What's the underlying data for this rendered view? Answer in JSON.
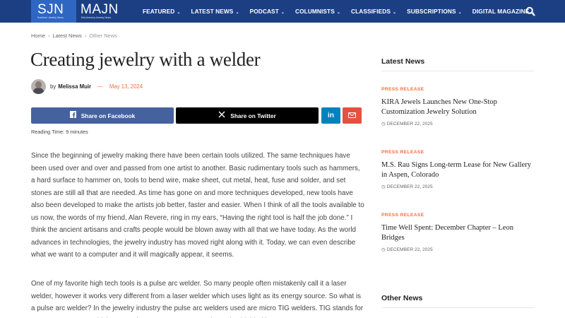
{
  "brand": {
    "logo1": "SJN",
    "logo1_tagline": "Southern Jewelry News",
    "logo2": "MAJN",
    "logo2_tagline": "Mid-America Jewelry News",
    "primary_color": "#1c3f84",
    "accent_color": "#ff6b3d"
  },
  "nav": {
    "items": [
      {
        "label": "FEATURED"
      },
      {
        "label": "LATEST NEWS"
      },
      {
        "label": "PODCAST"
      },
      {
        "label": "COLUMNISTS"
      },
      {
        "label": "CLASSIFIEDS"
      },
      {
        "label": "SUBSCRIPTIONS"
      },
      {
        "label": "DIGITAL MAGAZINE"
      }
    ],
    "chevron": "⌄",
    "search_icon": "search-icon"
  },
  "breadcrumb": {
    "home": "Home",
    "section": "Latest News",
    "current": "Other News",
    "separator": "›"
  },
  "article": {
    "title": "Creating jewelry with a welder",
    "by": "by",
    "author": "Melissa Muir",
    "dash": "—",
    "date": "May 13, 2024",
    "reading_time": "Reading Time: 9 minutes",
    "paragraphs": [
      "Since the beginning of jewelry making there have been certain tools utilized. The same techniques have been used over and over and passed from one artist to another. Basic rudimentary tools such as hammers, a hard surface to hammer on, tools to bend wire, make sheet, cut metal, heat, fuse and solder, and set stones are still all that are needed. As time has gone on and more techniques developed, new tools have also been developed to make the artists job better, faster and easier. When I think of all the tools available to us now, the words of my friend, Alan Revere, ring in my ears, “Having the right tool is half the job done.” I think the ancient artisans and crafts people would be blown away with all that we have today. As the world advances in technologies, the jewelry industry has moved right along with it. Today, we can even describe what we want to a computer and it will magically appear, it seems.",
      "One of my favorite high tech tools is a pulse arc welder. So many people often mistakenly call it a laser welder, however it works very different from a laser welder which uses light as its energy source. So what is a pulse arc welder? In the jewelry industry the pulse arc welders used are micro TIG welders. TIG stands for Tungsten Inert Gas which means that we use a tungsten electrode shielded by"
    ]
  },
  "share": {
    "facebook": "Share on Facebook",
    "twitter": "Share on Twitter",
    "facebook_color": "#45629f",
    "twitter_color": "#000000",
    "linkedin_color": "#0083bb",
    "email_color": "#e4523f"
  },
  "sidebar": {
    "latest_heading": "Latest News",
    "other_heading": "Other News",
    "items": [
      {
        "category": "PRESS RELEASE",
        "title": "KIRA Jewels Launches New One-Stop Customization Jewelry Solution",
        "date": "DECEMBER 22, 2025"
      },
      {
        "category": "PRESS RELEASE",
        "title": "M.S. Rau Signs Long-term Lease for New Gallery in Aspen, Colorado",
        "date": "DECEMBER 22, 2025"
      },
      {
        "category": "PRESS RELEASE",
        "title": "Time Well Spent: December Chapter – Leon Bridges",
        "date": "DECEMBER 22, 2025"
      }
    ]
  }
}
